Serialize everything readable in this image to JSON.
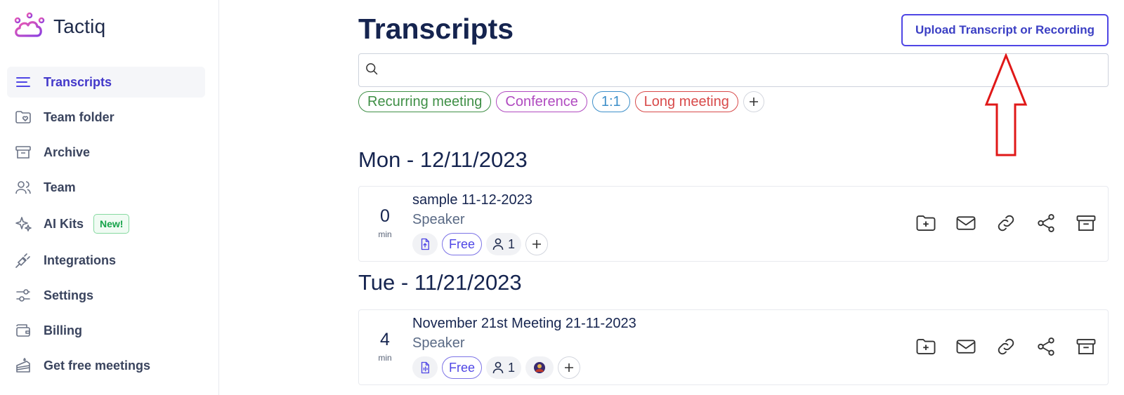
{
  "app": {
    "name": "Tactiq"
  },
  "sidebar": {
    "items": [
      {
        "label": "Transcripts",
        "icon": "menu-lines-icon",
        "active": true
      },
      {
        "label": "Team folder",
        "icon": "folder-heart-icon"
      },
      {
        "label": "Archive",
        "icon": "archive-icon"
      },
      {
        "label": "Team",
        "icon": "users-icon"
      },
      {
        "label": "AI Kits",
        "icon": "sparkles-icon",
        "badge": "New!"
      },
      {
        "label": "Integrations",
        "icon": "plug-icon"
      },
      {
        "label": "Settings",
        "icon": "sliders-icon"
      },
      {
        "label": "Billing",
        "icon": "wallet-icon"
      },
      {
        "label": "Get free meetings",
        "icon": "cake-icon"
      }
    ]
  },
  "main": {
    "title": "Transcripts",
    "upload_label": "Upload Transcript or Recording",
    "search": {
      "placeholder": "",
      "value": ""
    },
    "tags": [
      {
        "label": "Recurring meeting",
        "color": "#3f8f46"
      },
      {
        "label": "Conference",
        "color": "#b04ac0"
      },
      {
        "label": "1:1",
        "color": "#3d8fc9"
      },
      {
        "label": "Long meeting",
        "color": "#d84a4a"
      }
    ],
    "groups": [
      {
        "date": "Mon - 12/11/2023",
        "meetings": [
          {
            "duration": "0",
            "unit": "min",
            "title": "sample 11-12-2023",
            "speaker": "Speaker",
            "plan": "Free",
            "participants": "1",
            "has_avatar": false
          }
        ]
      },
      {
        "date": "Tue - 11/21/2023",
        "meetings": [
          {
            "duration": "4",
            "unit": "min",
            "title": "November 21st Meeting 21-11-2023",
            "speaker": "Speaker",
            "plan": "Free",
            "participants": "1",
            "has_avatar": true
          }
        ]
      }
    ]
  },
  "annotation": {
    "type": "red-arrow",
    "points_to": "upload-button",
    "color": "#e01818"
  },
  "colors": {
    "accent": "#4f46e5",
    "title": "#15244f",
    "annotation": "#e01818"
  }
}
